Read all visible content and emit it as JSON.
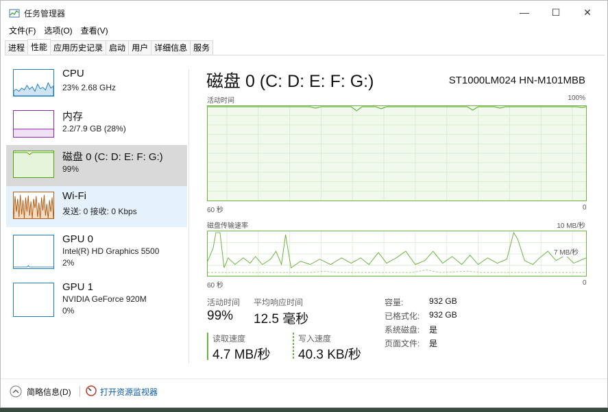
{
  "window": {
    "title": "任务管理器",
    "controls": {
      "minimize": "—",
      "maximize": "☐",
      "close": "✕"
    }
  },
  "menu": [
    "文件(F)",
    "选项(O)",
    "查看(V)"
  ],
  "tabs": [
    "进程",
    "性能",
    "应用历史记录",
    "启动",
    "用户",
    "详细信息",
    "服务"
  ],
  "active_tab": "性能",
  "sidebar": {
    "items": [
      {
        "name": "CPU",
        "line1": "23% 2.68 GHz",
        "line2": "",
        "color": "#1a7cbf"
      },
      {
        "name": "内存",
        "line1": "2.2/7.9 GB (28%)",
        "line2": "",
        "color": "#8b2aa8"
      },
      {
        "name": "磁盘 0 (C: D: E: F: G:)",
        "line1": "99%",
        "line2": "",
        "color": "#4da600"
      },
      {
        "name": "Wi-Fi",
        "line1": "发送: 0 接收: 0 Kbps",
        "line2": "",
        "color": "#b35a0f"
      },
      {
        "name": "GPU 0",
        "line1": "Intel(R) HD Graphics 5500",
        "line2": "2%",
        "color": "#1a7cbf"
      },
      {
        "name": "GPU 1",
        "line1": "NVIDIA GeForce 920M",
        "line2": "0%",
        "color": "#1a7cbf"
      }
    ]
  },
  "main": {
    "title": "磁盘 0 (C: D: E: F: G:)",
    "model": "ST1000LM024 HN-M101MBB",
    "graph1": {
      "label": "活动时间",
      "max": "100%",
      "xleft": "60 秒",
      "xright": "0"
    },
    "graph2": {
      "label": "磁盘传输速率",
      "max": "10 MB/秒",
      "mid": "7 MB/秒",
      "xleft": "60 秒",
      "xright": "0"
    },
    "stats": {
      "active_label": "活动时间",
      "active_value": "99%",
      "response_label": "平均响应时间",
      "response_value": "12.5 毫秒",
      "read_label": "读取速度",
      "read_value": "4.7 MB/秒",
      "write_label": "写入速度",
      "write_value": "40.3 KB/秒"
    },
    "props": [
      {
        "k": "容量:",
        "v": "932 GB"
      },
      {
        "k": "已格式化:",
        "v": "932 GB"
      },
      {
        "k": "系统磁盘:",
        "v": "是"
      },
      {
        "k": "页面文件:",
        "v": "是"
      }
    ]
  },
  "footer": {
    "less": "简略信息(D)",
    "monitor": "打开资源监视器"
  },
  "colors": {
    "disk_green": "#6bb33f",
    "link_blue": "#0b5cad"
  }
}
